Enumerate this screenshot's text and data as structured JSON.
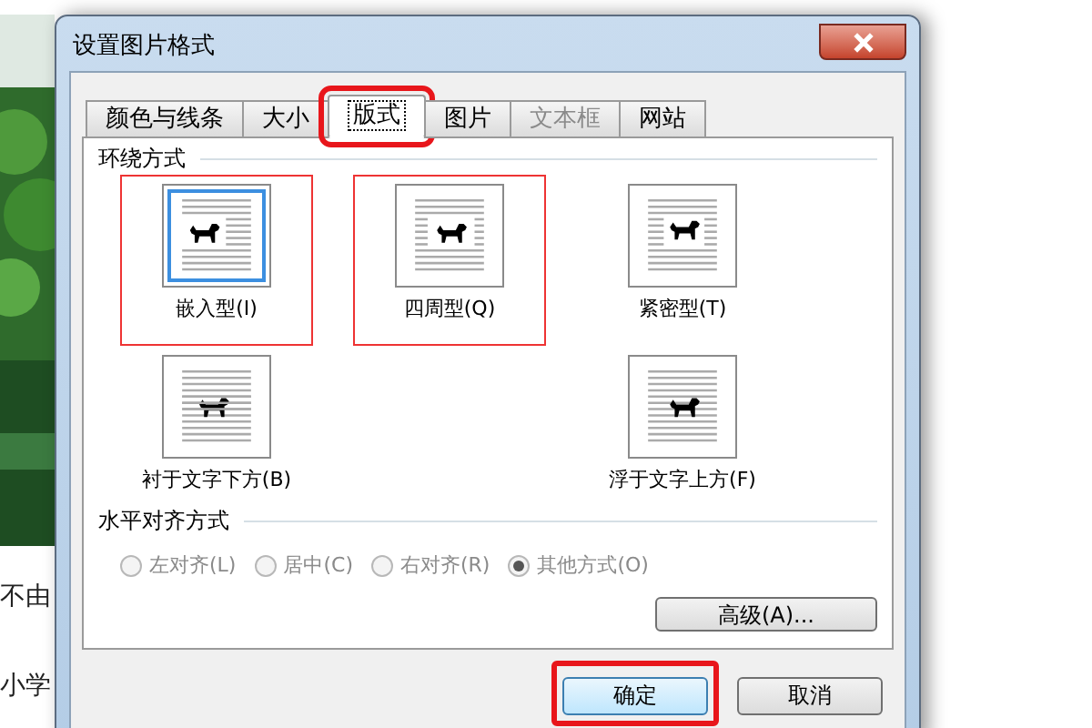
{
  "background": {
    "texts": [
      "不由",
      "小学"
    ]
  },
  "dialog": {
    "title": "设置图片格式",
    "tabs": [
      {
        "label": "颜色与线条",
        "selected": false,
        "disabled": false,
        "annotated": false
      },
      {
        "label": "大小",
        "selected": false,
        "disabled": false,
        "annotated": false
      },
      {
        "label": "版式",
        "selected": true,
        "disabled": false,
        "annotated": true
      },
      {
        "label": "图片",
        "selected": false,
        "disabled": false,
        "annotated": false
      },
      {
        "label": "文本框",
        "selected": false,
        "disabled": true,
        "annotated": false
      },
      {
        "label": "网站",
        "selected": false,
        "disabled": false,
        "annotated": false
      }
    ],
    "wrap": {
      "heading": "环绕方式",
      "options": [
        {
          "kind": "inline",
          "label": "嵌入型(I)",
          "selected": true,
          "annotated": true
        },
        {
          "kind": "square",
          "label": "四周型(Q)",
          "selected": false,
          "annotated": true
        },
        {
          "kind": "tight",
          "label": "紧密型(T)",
          "selected": false,
          "annotated": false
        },
        {
          "kind": "behind",
          "label": "衬于文字下方(B)",
          "selected": false,
          "annotated": false
        },
        {
          "kind": "front",
          "label": "浮于文字上方(F)",
          "selected": false,
          "annotated": false
        }
      ]
    },
    "align": {
      "heading": "水平对齐方式",
      "options": [
        {
          "label": "左对齐(L)",
          "selected": false,
          "disabled": true
        },
        {
          "label": "居中(C)",
          "selected": false,
          "disabled": true
        },
        {
          "label": "右对齐(R)",
          "selected": false,
          "disabled": true
        },
        {
          "label": "其他方式(O)",
          "selected": true,
          "disabled": true
        }
      ]
    },
    "advanced_button": "高级(A)...",
    "buttons": [
      {
        "label": "确定",
        "default": true,
        "annotated": true
      },
      {
        "label": "取消",
        "default": false,
        "annotated": false
      }
    ]
  }
}
